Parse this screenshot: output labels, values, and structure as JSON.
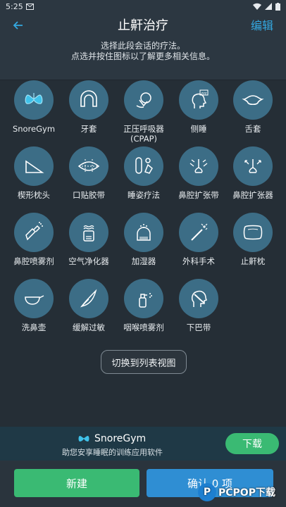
{
  "status": {
    "time": "5:25",
    "mail_icon": "gmail-icon",
    "icons": [
      "wifi-icon",
      "signal-icon",
      "battery-icon"
    ]
  },
  "header": {
    "title": "止鼾治疗",
    "edit_label": "编辑",
    "instructions_line1": "选择此段会话的疗法。",
    "instructions_line2": "点选并按住图标以了解更多相关信息。"
  },
  "remedies": [
    {
      "label": "SnoreGym",
      "icon": "snoregym-lungs-icon"
    },
    {
      "label": "牙套",
      "icon": "mouthguard-icon"
    },
    {
      "label": "正压呼吸器\n(CPAP)",
      "icon": "cpap-mask-icon"
    },
    {
      "label": "侧睡",
      "icon": "side-sleep-head-icon"
    },
    {
      "label": "舌套",
      "icon": "tongue-retainer-icon"
    },
    {
      "label": "楔形枕头",
      "icon": "wedge-pillow-icon"
    },
    {
      "label": "口贴胶带",
      "icon": "mouth-tape-icon"
    },
    {
      "label": "睡姿疗法",
      "icon": "positional-therapy-icon"
    },
    {
      "label": "鼻腔扩张带",
      "icon": "nasal-strip-icon"
    },
    {
      "label": "鼻腔扩张器",
      "icon": "nasal-dilator-icon"
    },
    {
      "label": "鼻腔喷雾剂",
      "icon": "nasal-spray-icon"
    },
    {
      "label": "空气净化器",
      "icon": "air-purifier-icon"
    },
    {
      "label": "加湿器",
      "icon": "humidifier-icon"
    },
    {
      "label": "外科手术",
      "icon": "surgery-wand-icon"
    },
    {
      "label": "止鼾枕",
      "icon": "anti-snore-pillow-icon"
    },
    {
      "label": "洗鼻壶",
      "icon": "neti-pot-icon"
    },
    {
      "label": "缓解过敏",
      "icon": "allergy-feather-icon"
    },
    {
      "label": "咽喉喷雾剂",
      "icon": "throat-spray-icon"
    },
    {
      "label": "下巴带",
      "icon": "chin-strap-icon"
    }
  ],
  "switch_view_label": "切换到列表视图",
  "promo": {
    "name": "SnoreGym",
    "description": "助您安享睡眠的训练应用软件",
    "download_label": "下载"
  },
  "footer": {
    "new_label": "新建",
    "confirm_label": "确认 0 项"
  },
  "watermark": {
    "text": "PCPOP下载"
  },
  "colors": {
    "background": "#2a343d",
    "icon_circle": "#3c6d86",
    "accent_blue": "#2f8ed3",
    "accent_green": "#3aba73",
    "edit_link": "#34a8e0"
  }
}
